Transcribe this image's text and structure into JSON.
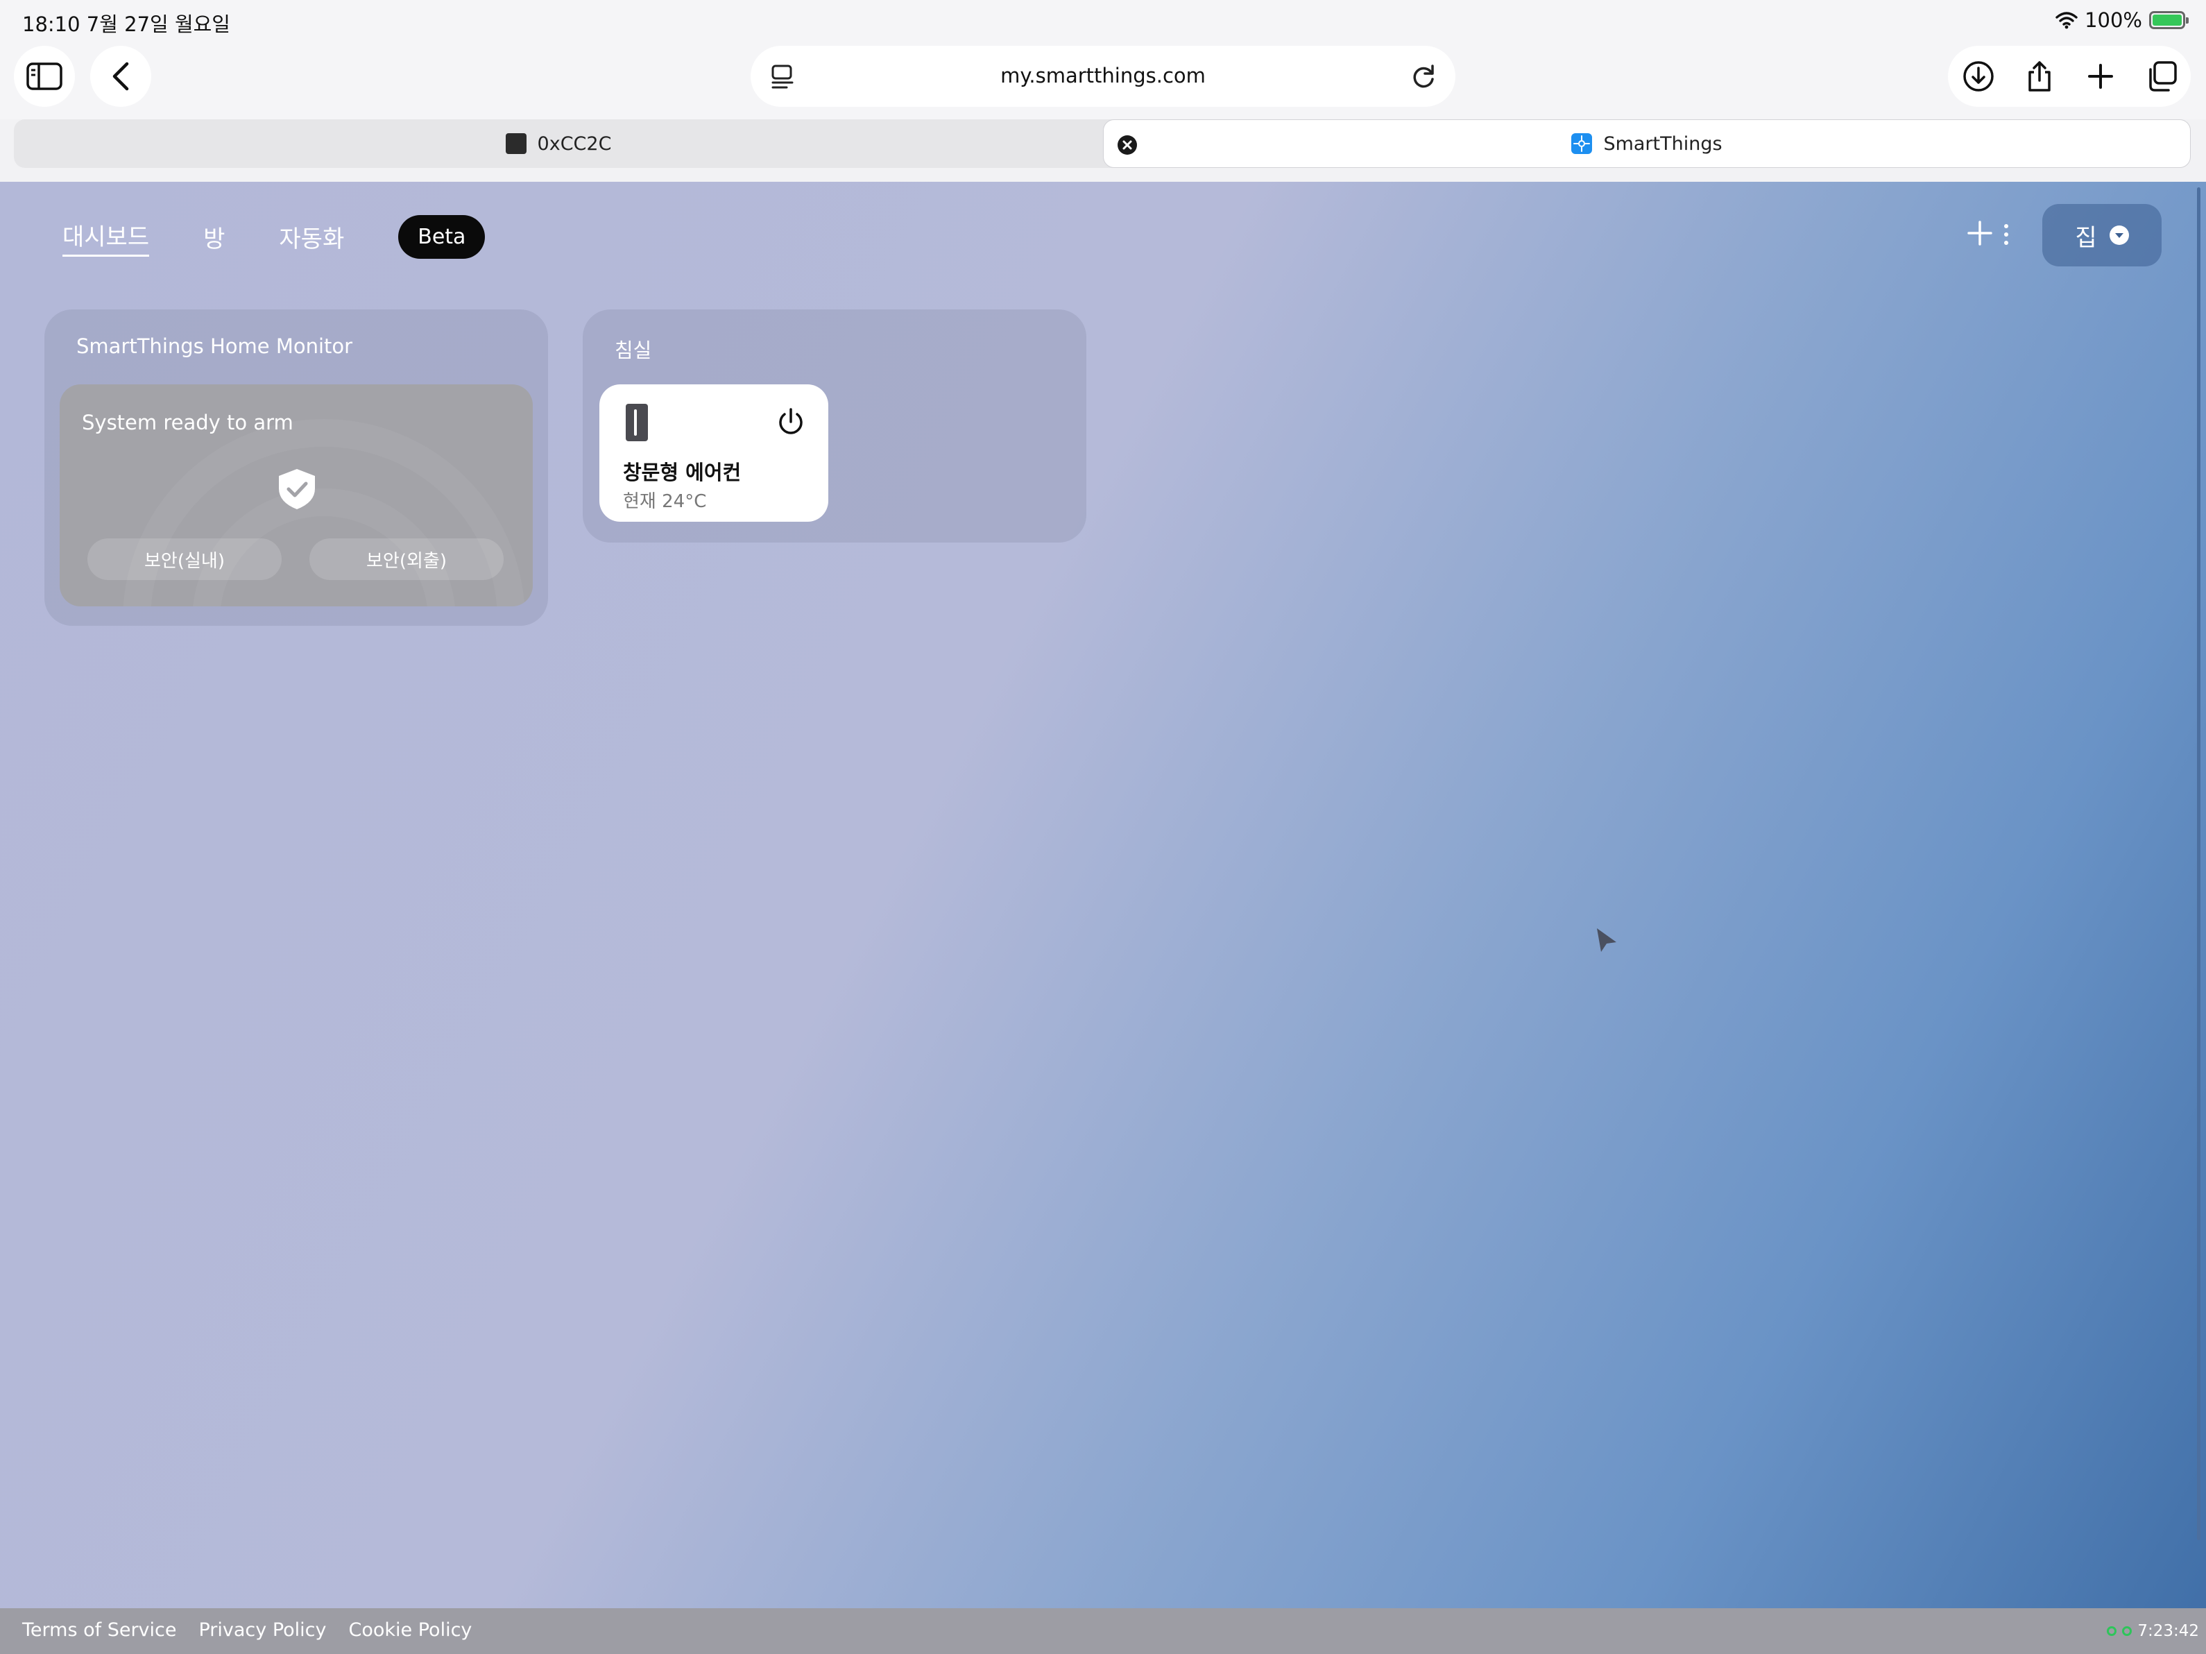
{
  "status_bar": {
    "time_date": "18:10  7월 27일 월요일",
    "battery": "100%",
    "battery_level": 1.0
  },
  "browser": {
    "url": "my.smartthings.com",
    "tabs": [
      {
        "title": "0xCC2C",
        "favicon_color": "#2b2b2b"
      },
      {
        "title": "SmartThings",
        "favicon_color": "#1d8ff0"
      }
    ]
  },
  "nav": {
    "items": [
      {
        "label": "대시보드"
      },
      {
        "label": "방"
      },
      {
        "label": "자동화"
      }
    ],
    "beta_label": "Beta",
    "location_label": "집"
  },
  "home_monitor": {
    "title": "SmartThings Home Monitor",
    "status": "System ready to arm",
    "stay_label": "보안(실내)",
    "away_label": "보안(외출)"
  },
  "room": {
    "title": "침실",
    "device": {
      "name": "창문형 에어컨",
      "status": "현재 24°C"
    }
  },
  "footer": {
    "links": [
      "Terms of Service",
      "Privacy Policy",
      "Cookie Policy"
    ],
    "time": "7:23:42"
  },
  "colors": {
    "gradient_light": "#b5bad9",
    "gradient_dark": "#3f6ea7",
    "beta_bg": "#0a0a0a",
    "status_dot": "#2ec55a"
  }
}
